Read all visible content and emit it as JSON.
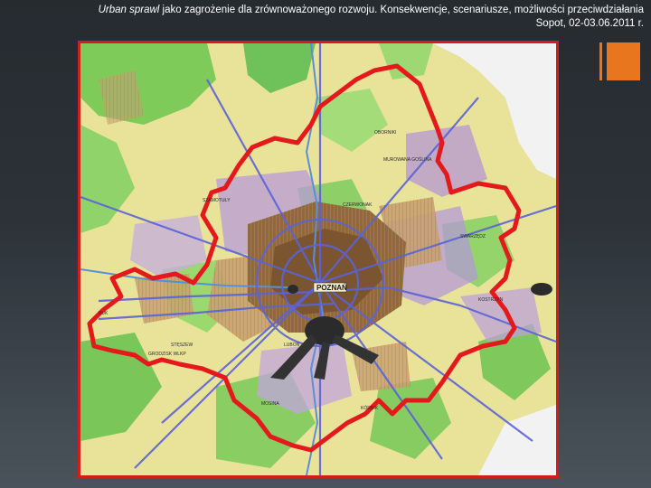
{
  "header": {
    "title_italic": "Urban sprawl",
    "title_rest": " jako zagrożenie dla zrównoważonego rozwoju. Konsekwencje, scenariusze, możliwości przeciwdziałania",
    "subtitle": "Sopot, 02-03.06.2011 r."
  },
  "colors": {
    "background": "#2c3238",
    "accent": "#e8761f",
    "frame_border": "#d31d1d",
    "boundary": "#e3191c"
  },
  "map": {
    "city_label": "POZNAŃ",
    "place_labels": [
      "OBORNIKI",
      "MUROWANA GOŚLINA",
      "SWARZĘDZ",
      "KÓRNIK",
      "MOSINA",
      "STĘSZEW",
      "BUK",
      "GRODZISK WLKP",
      "SZAMOTUŁY",
      "KOSTRZYN",
      "CZERWONAK",
      "LUBOŃ"
    ]
  }
}
